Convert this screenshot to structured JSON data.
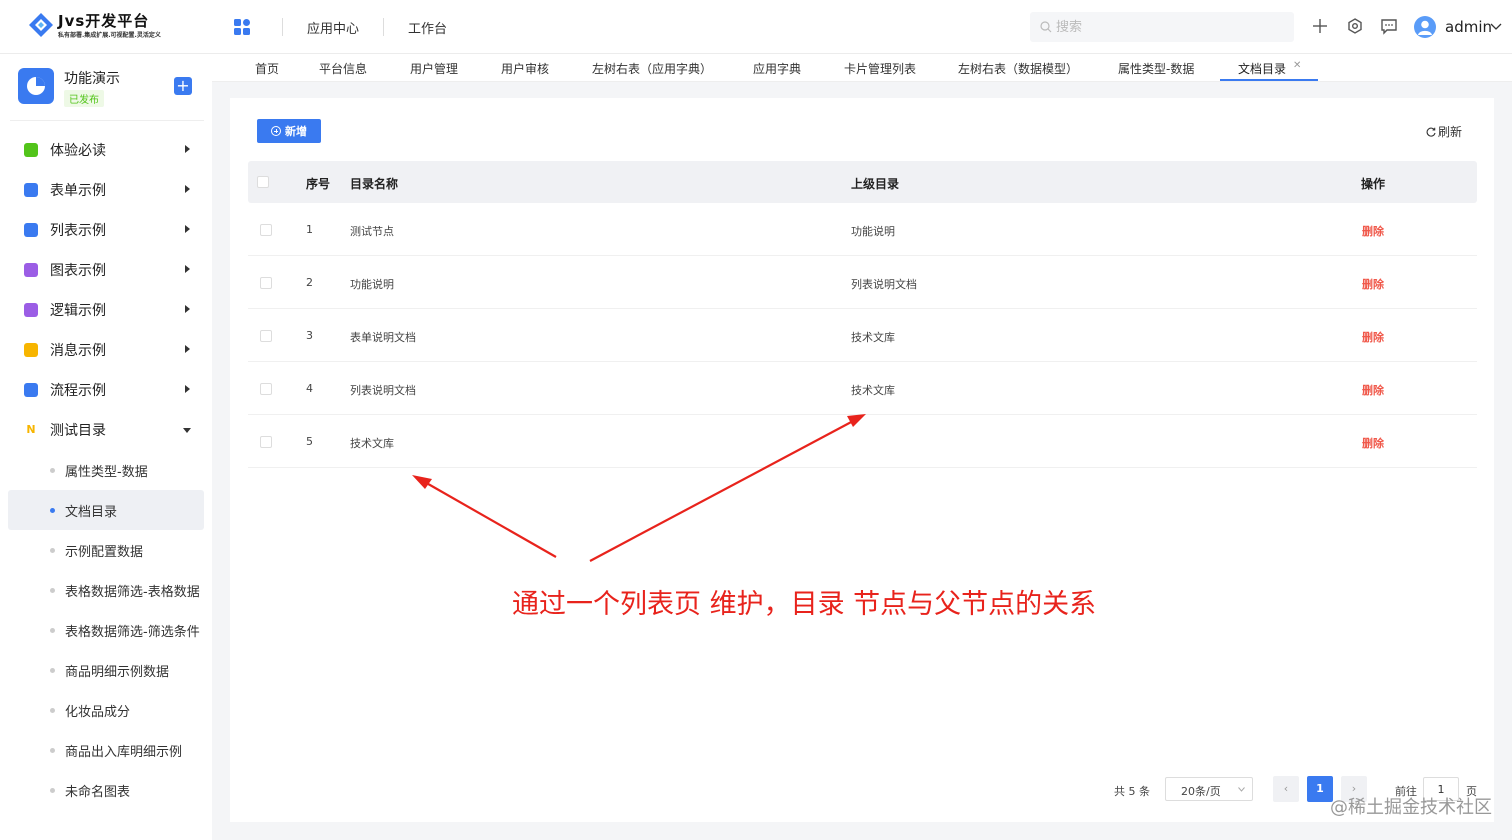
{
  "header": {
    "logo_title": "Jvs开发平台",
    "logo_subtitle": "私有部署.集成扩展.可视配置.灵活定义",
    "nav": [
      "应用中心",
      "工作台"
    ],
    "search_placeholder": "搜索",
    "user_name": "admin"
  },
  "sidebar": {
    "app_name": "功能演示",
    "app_status": "已发布",
    "menu": [
      {
        "label": "体验必读",
        "color": "#52c41a"
      },
      {
        "label": "表单示例",
        "color": "#3a7af0"
      },
      {
        "label": "列表示例",
        "color": "#3a7af0"
      },
      {
        "label": "图表示例",
        "color": "#9b5de5"
      },
      {
        "label": "逻辑示例",
        "color": "#9b5de5"
      },
      {
        "label": "消息示例",
        "color": "#f7b500"
      },
      {
        "label": "流程示例",
        "color": "#3a7af0"
      },
      {
        "label": "测试目录",
        "color": "#f7b500"
      }
    ],
    "sub_items": [
      "属性类型-数据",
      "文档目录",
      "示例配置数据",
      "表格数据筛选-表格数据",
      "表格数据筛选-筛选条件",
      "商品明细示例数据",
      "化妆品成分",
      "商品出入库明细示例",
      "未命名图表"
    ]
  },
  "tabs": [
    "首页",
    "平台信息",
    "用户管理",
    "用户审核",
    "左树右表（应用字典）",
    "应用字典",
    "卡片管理列表",
    "左树右表（数据模型）",
    "属性类型-数据",
    "文档目录"
  ],
  "toolbar": {
    "new_label": "新增",
    "refresh_label": "刷新"
  },
  "table": {
    "headers": [
      "序号",
      "目录名称",
      "上级目录",
      "操作"
    ],
    "rows": [
      {
        "index": "1",
        "name": "测试节点",
        "parent": "功能说明",
        "action": "删除"
      },
      {
        "index": "2",
        "name": "功能说明",
        "parent": "列表说明文档",
        "action": "删除"
      },
      {
        "index": "3",
        "name": "表单说明文档",
        "parent": "技术文库",
        "action": "删除"
      },
      {
        "index": "4",
        "name": "列表说明文档",
        "parent": "技术文库",
        "action": "删除"
      },
      {
        "index": "5",
        "name": "技术文库",
        "parent": "",
        "action": "删除"
      }
    ]
  },
  "pagination": {
    "total": "共 5 条",
    "page_size": "20条/页",
    "current_page": "1",
    "goto_label": "前往",
    "goto_value": "1",
    "page_suffix": "页"
  },
  "annotation": "通过一个列表页 维护，目录 节点与父节点的关系",
  "credit": "@稀土掘金技术社区"
}
